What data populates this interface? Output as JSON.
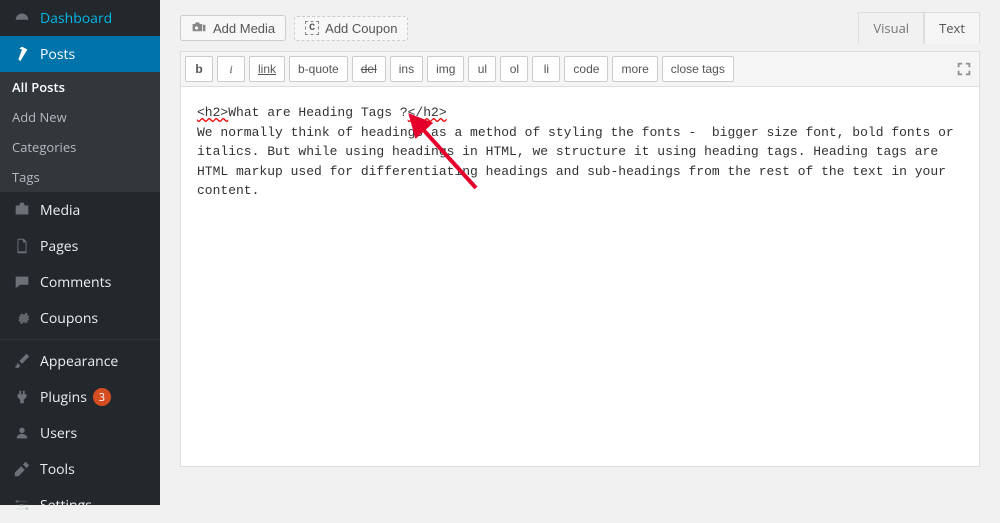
{
  "sidebar": {
    "items": [
      {
        "label": "Dashboard",
        "icon": "dashboard-icon",
        "type": "item"
      },
      {
        "label": "Posts",
        "icon": "pin-icon",
        "type": "item",
        "active": true,
        "submenu": [
          "All Posts",
          "Add New",
          "Categories",
          "Tags"
        ],
        "submenu_active": 0
      },
      {
        "label": "Media",
        "icon": "media-icon",
        "type": "item"
      },
      {
        "label": "Pages",
        "icon": "pages-icon",
        "type": "item"
      },
      {
        "label": "Comments",
        "icon": "comments-icon",
        "type": "item"
      },
      {
        "label": "Coupons",
        "icon": "gear-icon",
        "type": "item"
      },
      {
        "type": "sep"
      },
      {
        "label": "Appearance",
        "icon": "brush-icon",
        "type": "item"
      },
      {
        "label": "Plugins",
        "icon": "plug-icon",
        "type": "item",
        "badge": "3"
      },
      {
        "label": "Users",
        "icon": "users-icon",
        "type": "item"
      },
      {
        "label": "Tools",
        "icon": "tools-icon",
        "type": "item"
      },
      {
        "label": "Settings",
        "icon": "settings-icon",
        "type": "item"
      }
    ]
  },
  "toolbar": {
    "add_media": "Add Media",
    "add_coupon": "Add Coupon"
  },
  "tabs": {
    "visual": "Visual",
    "text": "Text"
  },
  "editor_buttons": {
    "b": "b",
    "i": "i",
    "link": "link",
    "bquote": "b-quote",
    "del": "del",
    "ins": "ins",
    "img": "img",
    "ul": "ul",
    "ol": "ol",
    "li": "li",
    "code": "code",
    "more": "more",
    "close": "close tags"
  },
  "editor_content": {
    "line1_open": "<h2>",
    "line1_text": "What are Heading Tags ?",
    "line1_close": "</h2>",
    "body": "We normally think of headings as a method of styling the fonts -  bigger size font, bold fonts or italics. But while using headings in HTML, we structure it using heading tags. Heading tags are HTML markup used for differentiating headings and sub-headings from the rest of the text in your content."
  }
}
